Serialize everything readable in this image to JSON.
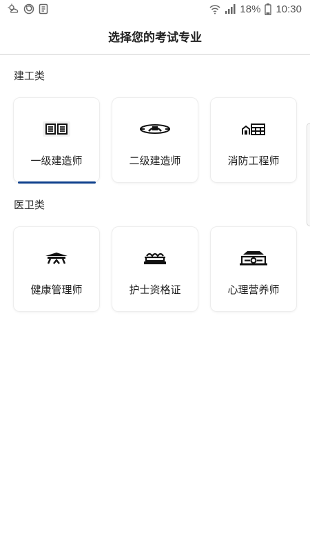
{
  "status_bar": {
    "battery_percent": "18%",
    "time": "10:30"
  },
  "header": {
    "title": "选择您的考试专业"
  },
  "sections": [
    {
      "heading": "建工类",
      "items": [
        {
          "label": "一级建造师",
          "icon": "book-icon",
          "selected": true
        },
        {
          "label": "二级建造师",
          "icon": "ring-road-icon",
          "selected": false
        },
        {
          "label": "消防工程师",
          "icon": "building-icon",
          "selected": false
        }
      ]
    },
    {
      "heading": "医卫类",
      "items": [
        {
          "label": "健康管理师",
          "icon": "pavilion-icon",
          "selected": false
        },
        {
          "label": "护士资格证",
          "icon": "bed-icon",
          "selected": false
        },
        {
          "label": "心理营养师",
          "icon": "house-icon",
          "selected": false
        }
      ]
    }
  ],
  "colors": {
    "accent": "#0d3f8c",
    "card_border": "#ededed",
    "divider": "#cfcfcf"
  }
}
